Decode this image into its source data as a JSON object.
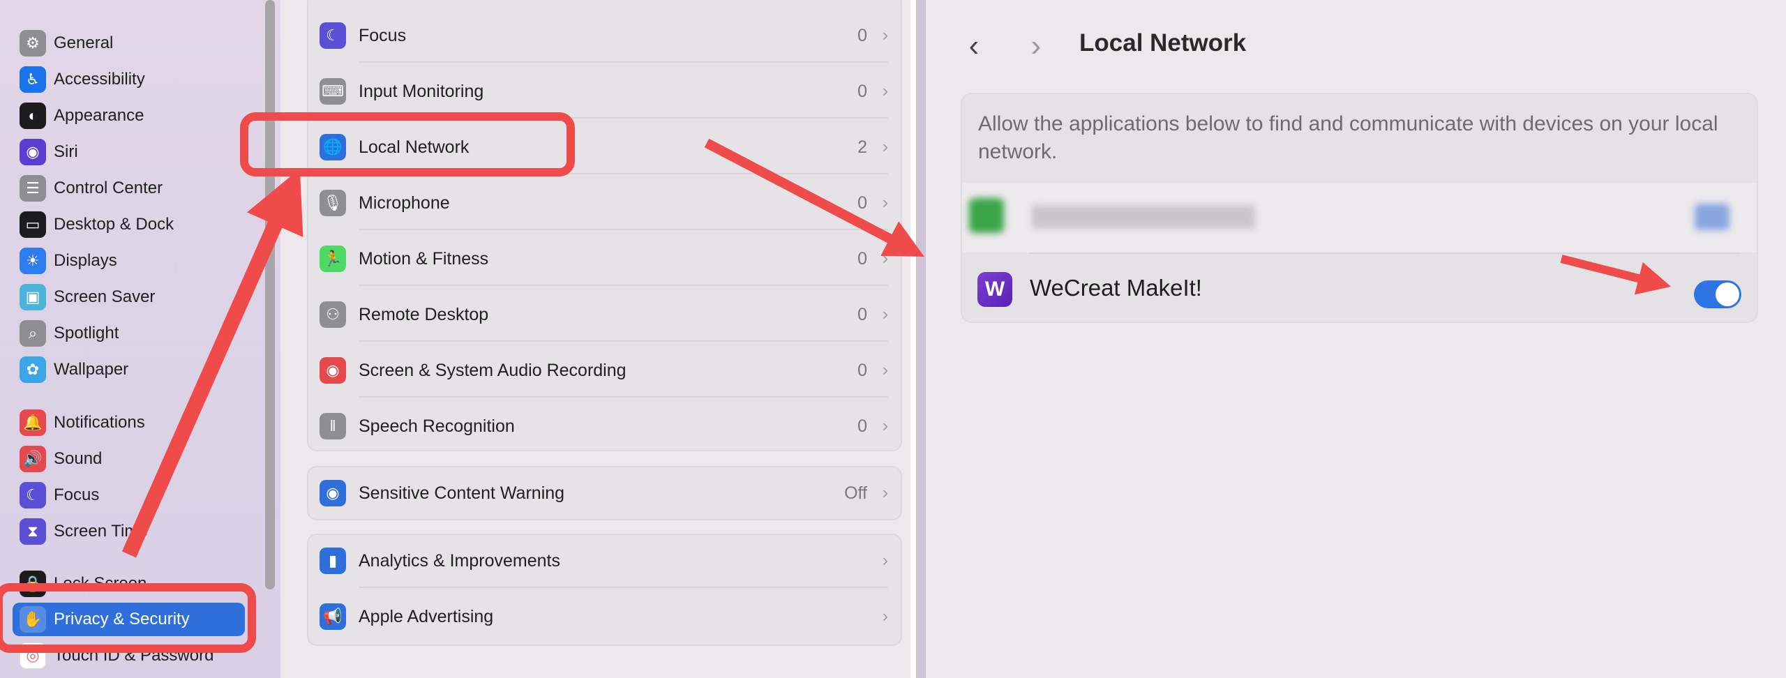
{
  "sidebar": {
    "items": [
      {
        "label": "General",
        "icon": "gear-icon",
        "color": "#8e8e93",
        "glyph": "⚙"
      },
      {
        "label": "Accessibility",
        "icon": "accessibility-icon",
        "color": "#1a73e8",
        "glyph": "♿"
      },
      {
        "label": "Appearance",
        "icon": "appearance-icon",
        "color": "#1c1c1e",
        "glyph": "◐"
      },
      {
        "label": "Siri",
        "icon": "siri-icon",
        "color": "#5b3dd1",
        "glyph": "◉"
      },
      {
        "label": "Control Center",
        "icon": "control-center-icon",
        "color": "#8e8e93",
        "glyph": "☰"
      },
      {
        "label": "Desktop & Dock",
        "icon": "dock-icon",
        "color": "#1c1c1e",
        "glyph": "▭"
      },
      {
        "label": "Displays",
        "icon": "displays-icon",
        "color": "#2f7bf0",
        "glyph": "☀"
      },
      {
        "label": "Screen Saver",
        "icon": "screen-saver-icon",
        "color": "#4cb3d9",
        "glyph": "▣"
      },
      {
        "label": "Spotlight",
        "icon": "spotlight-icon",
        "color": "#8e8e93",
        "glyph": "⌕"
      },
      {
        "label": "Wallpaper",
        "icon": "wallpaper-icon",
        "color": "#3aa6e8",
        "glyph": "✿"
      },
      {
        "label": "Notifications",
        "icon": "notifications-icon",
        "color": "#e5484d",
        "glyph": "🔔"
      },
      {
        "label": "Sound",
        "icon": "sound-icon",
        "color": "#e5484d",
        "glyph": "🔊"
      },
      {
        "label": "Focus",
        "icon": "moon-icon",
        "color": "#5b4fd6",
        "glyph": "☾"
      },
      {
        "label": "Screen Time",
        "icon": "hourglass-icon",
        "color": "#5b4fd6",
        "glyph": "⧗"
      },
      {
        "label": "Lock Screen",
        "icon": "lock-icon",
        "color": "#1c1c1e",
        "glyph": "🔒"
      },
      {
        "label": "Privacy & Security",
        "icon": "hand-icon",
        "color": "#2f6fdb",
        "glyph": "✋"
      },
      {
        "label": "Touch ID & Password",
        "icon": "fingerprint-icon",
        "color": "#ffffff",
        "glyph": "◎"
      }
    ]
  },
  "privacy_list": {
    "group1": [
      {
        "label": "Focus",
        "value": "0",
        "icon": "moon-icon",
        "color": "#5b4fd6",
        "glyph": "☾"
      },
      {
        "label": "Input Monitoring",
        "value": "0",
        "icon": "keyboard-icon",
        "color": "#8e8e93",
        "glyph": "⌨"
      },
      {
        "label": "Local Network",
        "value": "2",
        "icon": "globe-icon",
        "color": "#2f6fdb",
        "glyph": "🌐"
      },
      {
        "label": "Microphone",
        "value": "0",
        "icon": "microphone-icon",
        "color": "#8e8e93",
        "glyph": "🎙"
      },
      {
        "label": "Motion & Fitness",
        "value": "0",
        "icon": "motion-icon",
        "color": "#4cd964",
        "glyph": "🏃"
      },
      {
        "label": "Remote Desktop",
        "value": "0",
        "icon": "binoculars-icon",
        "color": "#8e8e93",
        "glyph": "⚇"
      },
      {
        "label": "Screen & System Audio Recording",
        "value": "0",
        "icon": "record-icon",
        "color": "#e5484d",
        "glyph": "◉"
      },
      {
        "label": "Speech Recognition",
        "value": "0",
        "icon": "waveform-icon",
        "color": "#8e8e93",
        "glyph": "‖"
      }
    ],
    "group2": [
      {
        "label": "Sensitive Content Warning",
        "value": "Off",
        "icon": "eye-icon",
        "color": "#2f6fdb",
        "glyph": "◉"
      }
    ],
    "group3": [
      {
        "label": "Analytics & Improvements",
        "value": "",
        "icon": "analytics-icon",
        "color": "#2f6fdb",
        "glyph": "▮"
      },
      {
        "label": "Apple Advertising",
        "value": "",
        "icon": "megaphone-icon",
        "color": "#2f6fdb",
        "glyph": "📢"
      }
    ]
  },
  "chevron": "›",
  "detail": {
    "title": "Local Network",
    "back": "‹",
    "forward": "›",
    "description": "Allow the applications below to find and communicate with devices on your local network.",
    "app_name": "WeCreat MakeIt!",
    "app_glyph": "W",
    "toggle_on": true
  },
  "colors": {
    "accent": "#2f6fdb",
    "annotation": "#ef4b4b",
    "toggle": "#2f74e5"
  }
}
